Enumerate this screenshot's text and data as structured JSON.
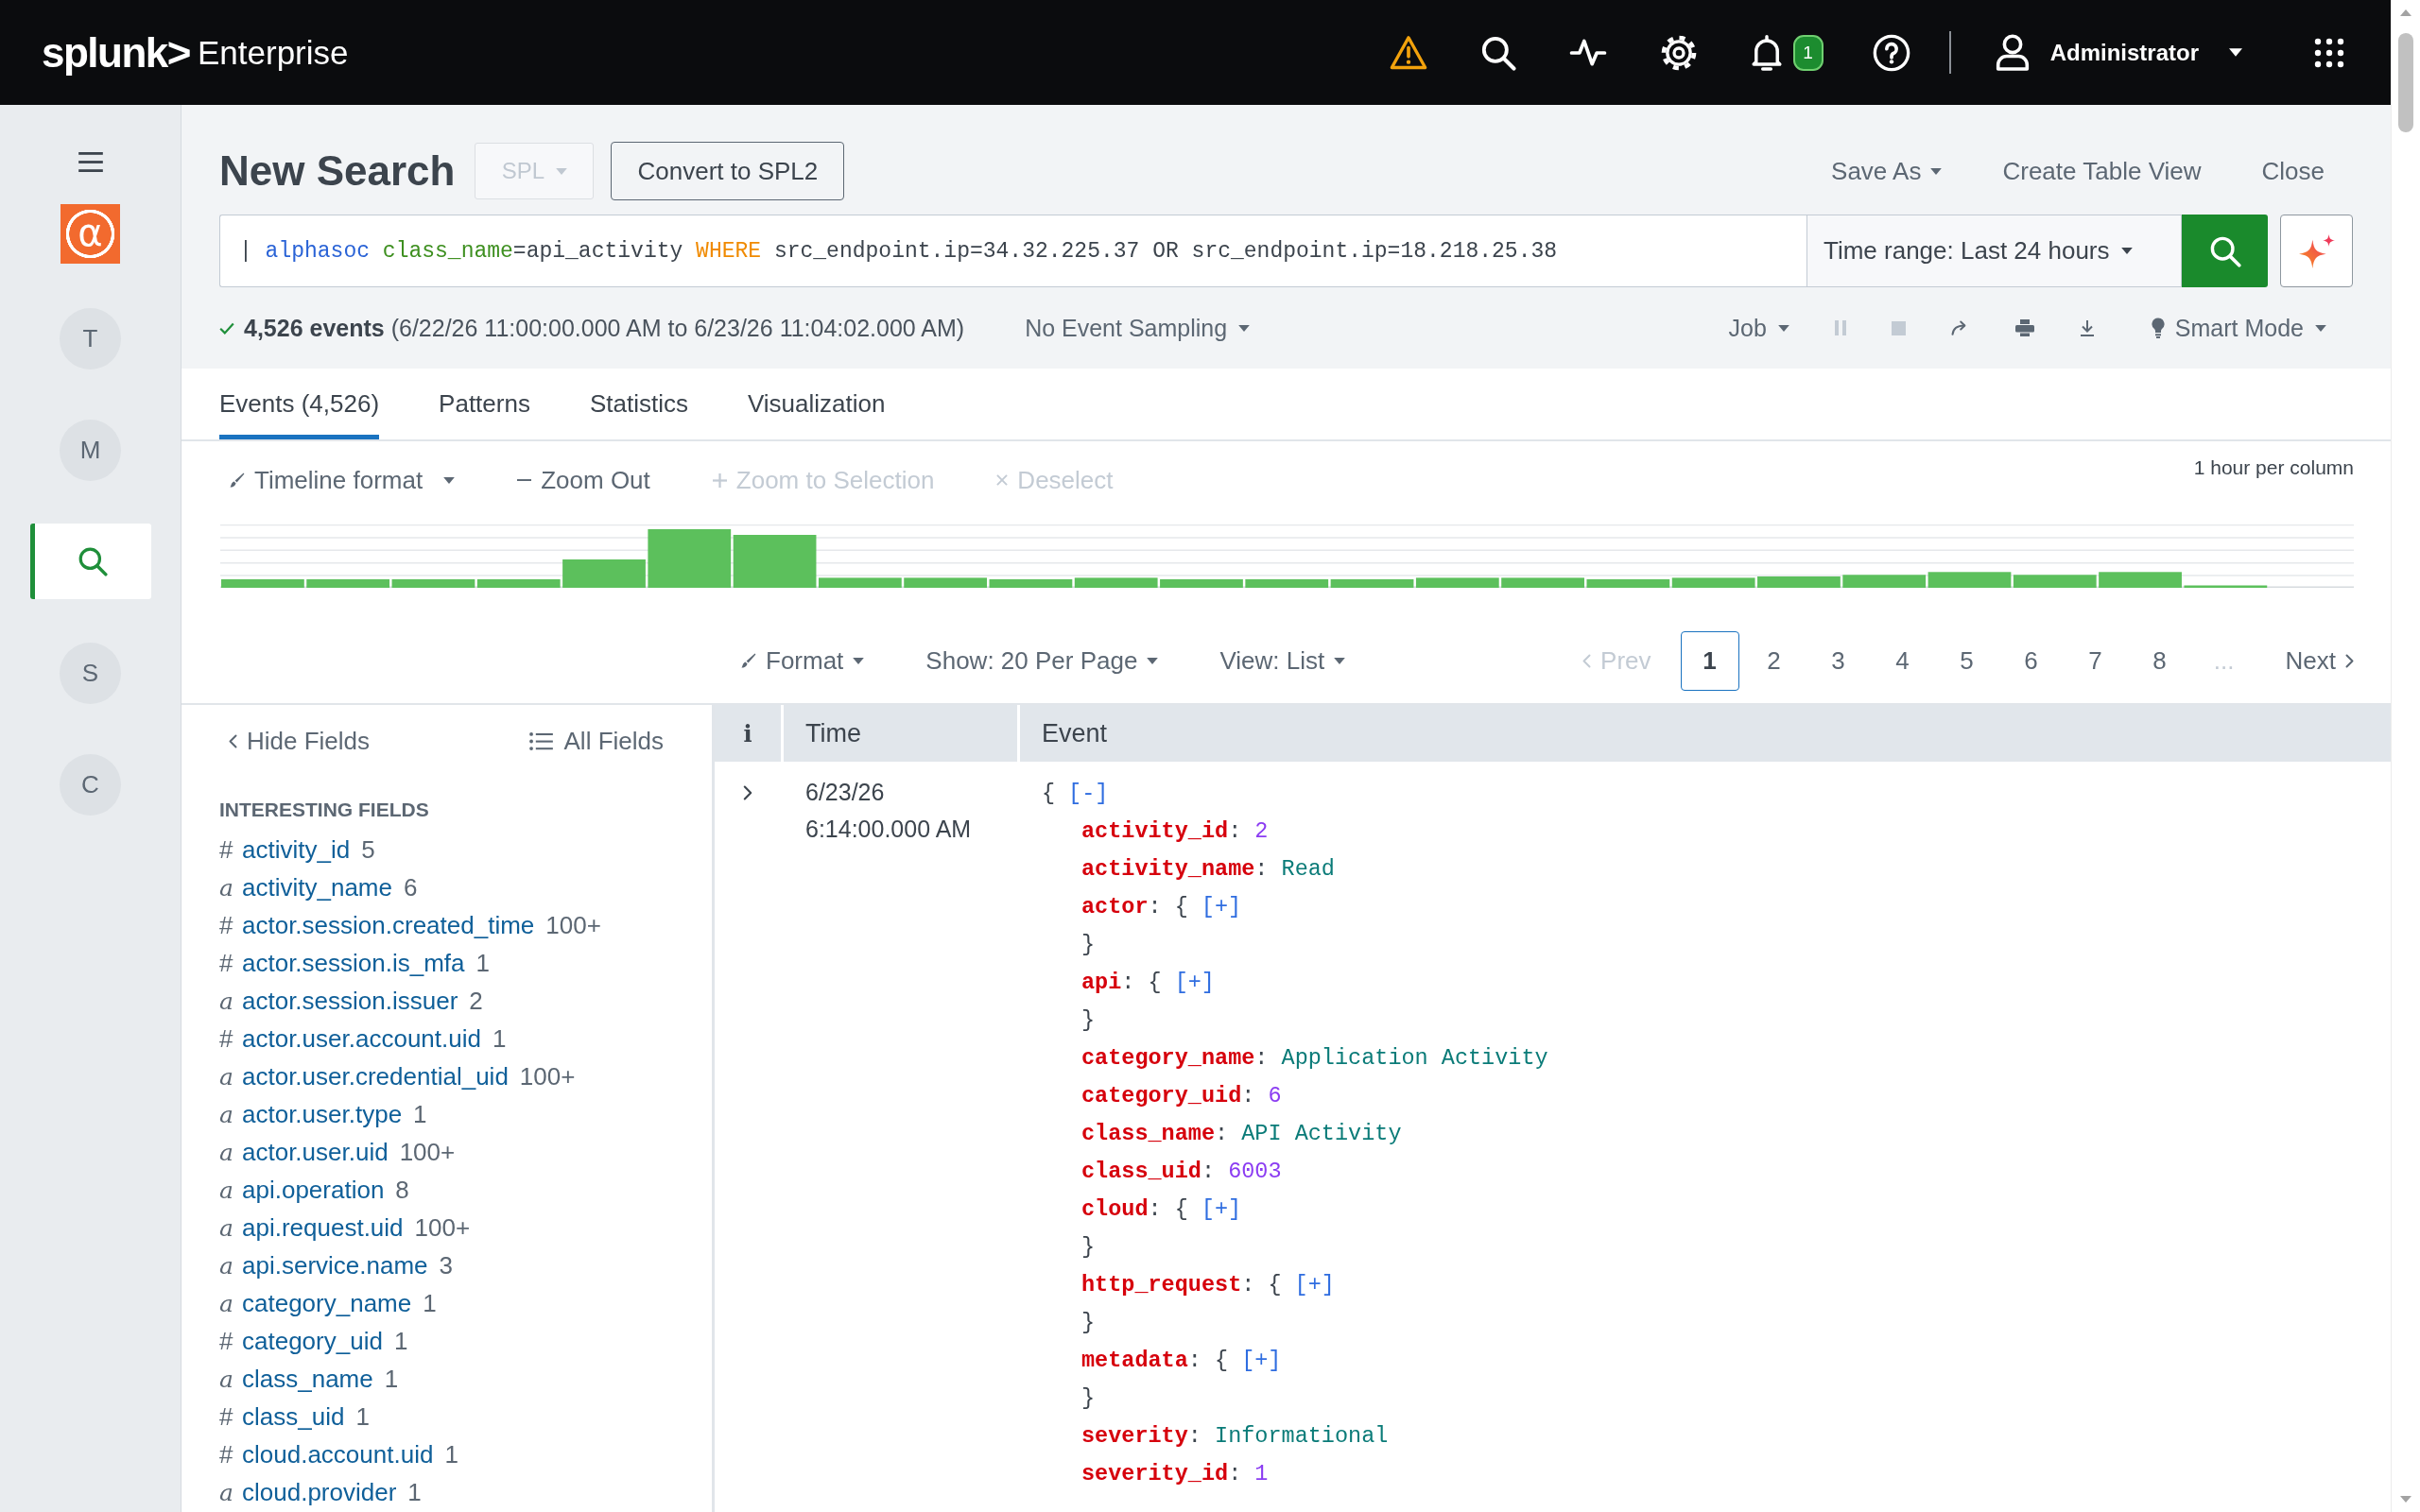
{
  "top_bar": {
    "brand": "splunk>",
    "product": "Enterprise",
    "notifications": {
      "badge": "1"
    },
    "user": {
      "name": "Administrator"
    }
  },
  "app_nav": {
    "logo": "α",
    "items": [
      {
        "kind": "letter",
        "label": "T",
        "selected": false
      },
      {
        "kind": "letter",
        "label": "M",
        "selected": false
      },
      {
        "kind": "search",
        "selected": true
      },
      {
        "kind": "letter",
        "label": "S",
        "selected": false
      },
      {
        "kind": "letter",
        "label": "C",
        "selected": false
      }
    ]
  },
  "search_header": {
    "title": "New Search",
    "language": {
      "label": "SPL",
      "disabled": true
    },
    "convert_button": "Convert to SPL2",
    "actions": [
      {
        "kind": "menu",
        "label": "Save As"
      },
      {
        "kind": "link",
        "label": "Create Table View"
      },
      {
        "kind": "link",
        "label": "Close"
      }
    ],
    "query": [
      {
        "kind": "plain",
        "text": "| "
      },
      {
        "kind": "command",
        "text": "alphasoc"
      },
      {
        "kind": "argument",
        "text": " class_name"
      },
      {
        "kind": "plain",
        "text": "=api_activity "
      },
      {
        "kind": "keyword",
        "text": "WHERE"
      },
      {
        "kind": "plain",
        "text": " src_endpoint.ip=34.32.225.37 OR src_endpoint.ip=18.218.25.38"
      }
    ],
    "time_range": "Time range: Last 24 hours",
    "summary": "**4,526 events** (6/22/26 11:00:00.000 AM to 6/23/26 11:04:02.000 AM)",
    "sampling": "No Event Sampling",
    "job": "Job",
    "job_controls": [
      {
        "kind": "pause",
        "disabled": true
      },
      {
        "kind": "stop",
        "disabled": true
      },
      {
        "kind": "share",
        "disabled": false
      },
      {
        "kind": "print",
        "disabled": false
      },
      {
        "kind": "export",
        "disabled": false
      }
    ],
    "mode": "Smart Mode"
  },
  "tabs": [
    {
      "label": "Events (4,526)",
      "selected": true
    },
    {
      "label": "Patterns",
      "selected": false
    },
    {
      "label": "Statistics",
      "selected": false
    },
    {
      "label": "Visualization",
      "selected": false
    }
  ],
  "timeline": {
    "controls": [
      {
        "kind": "format",
        "label": "Timeline format",
        "disabled": false
      },
      {
        "kind": "zoom-out",
        "label": "Zoom Out",
        "disabled": false
      },
      {
        "kind": "zoom-in",
        "label": "Zoom to Selection",
        "disabled": true
      },
      {
        "kind": "deselect",
        "label": "Deselect",
        "disabled": true
      }
    ],
    "scale": "1 hour per column"
  },
  "results_bar": {
    "format": "Format",
    "per_page": "Show: 20 Per Page",
    "view": "View: List",
    "pagination": {
      "prev": {
        "label": "Prev",
        "disabled": true
      },
      "pages": [
        {
          "label": "1",
          "selected": true
        },
        {
          "label": "2",
          "selected": false
        },
        {
          "label": "3",
          "selected": false
        },
        {
          "label": "4",
          "selected": false
        },
        {
          "label": "5",
          "selected": false
        },
        {
          "label": "6",
          "selected": false
        },
        {
          "label": "7",
          "selected": false
        },
        {
          "label": "8",
          "selected": false
        }
      ],
      "ellipsis": "...",
      "next": {
        "label": "Next",
        "disabled": false
      }
    }
  },
  "fields_sidebar": {
    "hide": "Hide Fields",
    "all": "All Fields",
    "section": "INTERESTING FIELDS",
    "fields": [
      {
        "kind": "number",
        "marker": "#",
        "name": "activity_id",
        "count": "5"
      },
      {
        "kind": "string",
        "marker": "a",
        "name": "activity_name",
        "count": "6"
      },
      {
        "kind": "number",
        "marker": "#",
        "name": "actor.session.created_time",
        "count": "100+"
      },
      {
        "kind": "number",
        "marker": "#",
        "name": "actor.session.is_mfa",
        "count": "1"
      },
      {
        "kind": "string",
        "marker": "a",
        "name": "actor.session.issuer",
        "count": "2"
      },
      {
        "kind": "number",
        "marker": "#",
        "name": "actor.user.account.uid",
        "count": "1"
      },
      {
        "kind": "string",
        "marker": "a",
        "name": "actor.user.credential_uid",
        "count": "100+"
      },
      {
        "kind": "string",
        "marker": "a",
        "name": "actor.user.type",
        "count": "1"
      },
      {
        "kind": "string",
        "marker": "a",
        "name": "actor.user.uid",
        "count": "100+"
      },
      {
        "kind": "string",
        "marker": "a",
        "name": "api.operation",
        "count": "8"
      },
      {
        "kind": "string",
        "marker": "a",
        "name": "api.request.uid",
        "count": "100+"
      },
      {
        "kind": "string",
        "marker": "a",
        "name": "api.service.name",
        "count": "3"
      },
      {
        "kind": "string",
        "marker": "a",
        "name": "category_name",
        "count": "1"
      },
      {
        "kind": "number",
        "marker": "#",
        "name": "category_uid",
        "count": "1"
      },
      {
        "kind": "string",
        "marker": "a",
        "name": "class_name",
        "count": "1"
      },
      {
        "kind": "number",
        "marker": "#",
        "name": "class_uid",
        "count": "1"
      },
      {
        "kind": "number",
        "marker": "#",
        "name": "cloud.account.uid",
        "count": "1"
      },
      {
        "kind": "string",
        "marker": "a",
        "name": "cloud.provider",
        "count": "1"
      }
    ]
  },
  "events_table": {
    "columns": [
      {
        "label": "i"
      },
      {
        "label": "Time"
      },
      {
        "label": "Event"
      }
    ],
    "rows": [
      {
        "expanded": false,
        "time": "6/23/26 6:14:00.000 AM",
        "event": {
          "tokens": [
            {
              "kind": "punct",
              "text": "{"
            }
          ],
          "toggle": "[-]",
          "children": [
            {
              "tokens": [
                {
                  "kind": "key",
                  "text": "activity_id"
                },
                {
                  "kind": "punct",
                  "text": ": "
                },
                {
                  "kind": "number",
                  "text": "2"
                }
              ]
            },
            {
              "tokens": [
                {
                  "kind": "key",
                  "text": "activity_name"
                },
                {
                  "kind": "punct",
                  "text": ": "
                },
                {
                  "kind": "string",
                  "text": "Read"
                }
              ]
            },
            {
              "tokens": [
                {
                  "kind": "key",
                  "text": "actor"
                },
                {
                  "kind": "punct",
                  "text": ": {"
                }
              ],
              "toggle": "[+]"
            },
            {
              "tokens": [
                {
                  "kind": "punct",
                  "text": "}"
                }
              ]
            },
            {
              "tokens": [
                {
                  "kind": "key",
                  "text": "api"
                },
                {
                  "kind": "punct",
                  "text": ": {"
                }
              ],
              "toggle": "[+]"
            },
            {
              "tokens": [
                {
                  "kind": "punct",
                  "text": "}"
                }
              ]
            },
            {
              "tokens": [
                {
                  "kind": "key",
                  "text": "category_name"
                },
                {
                  "kind": "punct",
                  "text": ": "
                },
                {
                  "kind": "string",
                  "text": "Application Activity"
                }
              ]
            },
            {
              "tokens": [
                {
                  "kind": "key",
                  "text": "category_uid"
                },
                {
                  "kind": "punct",
                  "text": ": "
                },
                {
                  "kind": "number",
                  "text": "6"
                }
              ]
            },
            {
              "tokens": [
                {
                  "kind": "key",
                  "text": "class_name"
                },
                {
                  "kind": "punct",
                  "text": ": "
                },
                {
                  "kind": "string",
                  "text": "API Activity"
                }
              ]
            },
            {
              "tokens": [
                {
                  "kind": "key",
                  "text": "class_uid"
                },
                {
                  "kind": "punct",
                  "text": ": "
                },
                {
                  "kind": "number",
                  "text": "6003"
                }
              ]
            },
            {
              "tokens": [
                {
                  "kind": "key",
                  "text": "cloud"
                },
                {
                  "kind": "punct",
                  "text": ": {"
                }
              ],
              "toggle": "[+]"
            },
            {
              "tokens": [
                {
                  "kind": "punct",
                  "text": "}"
                }
              ]
            },
            {
              "tokens": [
                {
                  "kind": "key",
                  "text": "http_request"
                },
                {
                  "kind": "punct",
                  "text": ": {"
                }
              ],
              "toggle": "[+]"
            },
            {
              "tokens": [
                {
                  "kind": "punct",
                  "text": "}"
                }
              ]
            },
            {
              "tokens": [
                {
                  "kind": "key",
                  "text": "metadata"
                },
                {
                  "kind": "punct",
                  "text": ": {"
                }
              ],
              "toggle": "[+]"
            },
            {
              "tokens": [
                {
                  "kind": "punct",
                  "text": "}"
                }
              ]
            },
            {
              "tokens": [
                {
                  "kind": "key",
                  "text": "severity"
                },
                {
                  "kind": "punct",
                  "text": ": "
                },
                {
                  "kind": "string",
                  "text": "Informational"
                }
              ]
            },
            {
              "tokens": [
                {
                  "kind": "key",
                  "text": "severity_id"
                },
                {
                  "kind": "punct",
                  "text": ": "
                },
                {
                  "kind": "number",
                  "text": "1"
                }
              ]
            }
          ]
        }
      }
    ]
  }
}
